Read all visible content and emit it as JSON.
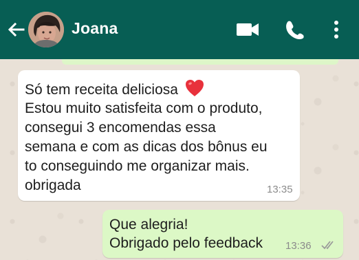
{
  "header": {
    "contact_name": "Joana",
    "icons": [
      "back-arrow-icon",
      "avatar",
      "video-call-icon",
      "phone-call-icon",
      "more-options-icon"
    ]
  },
  "messages": [
    {
      "direction": "incoming",
      "lines": [
        "Só tem receita deliciosa",
        "Estou muito satisfeita com o produto,",
        "consegui 3 encomendas essa",
        "semana e com as dicas dos bônus eu",
        "to conseguindo me organizar mais.",
        "obrigada"
      ],
      "emoji": "heart-icon",
      "time": "13:35"
    },
    {
      "direction": "outgoing",
      "lines": [
        "Que alegria!",
        "Obrigado pelo feedback"
      ],
      "time": "13:36",
      "status": "read-ticks-icon"
    }
  ],
  "colors": {
    "header": "#075e54",
    "incoming_bubble": "#ffffff",
    "outgoing_bubble": "#dcf8c6",
    "chat_background": "#e9e1d7"
  }
}
